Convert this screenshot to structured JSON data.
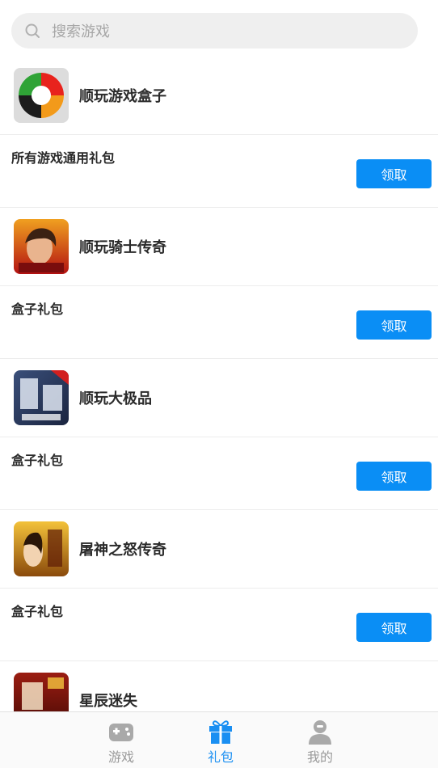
{
  "search": {
    "placeholder": "搜索游戏"
  },
  "games": [
    {
      "name": "顺玩游戏盒子",
      "icon": "shunwan-box-logo-icon",
      "gift": "所有游戏通用礼包",
      "button": "领取"
    },
    {
      "name": "顺玩骑士传奇",
      "icon": "knight-legend-game-icon",
      "gift": "盒子礼包",
      "button": "领取"
    },
    {
      "name": "顺玩大极品",
      "icon": "da-ji-pin-game-icon",
      "gift": "盒子礼包",
      "button": "领取"
    },
    {
      "name": "屠神之怒传奇",
      "icon": "tu-shen-game-icon",
      "gift": "盒子礼包",
      "button": "领取"
    },
    {
      "name": "星辰迷失",
      "icon": "xing-chen-game-icon"
    }
  ],
  "tabs": [
    {
      "label": "游戏",
      "icon": "gamepad-icon",
      "active": false
    },
    {
      "label": "礼包",
      "icon": "gift-icon",
      "active": true
    },
    {
      "label": "我的",
      "icon": "user-icon",
      "active": false
    }
  ],
  "colors": {
    "accent": "#0a8ef5",
    "tab_active": "#1a8ff2",
    "tab_inactive": "#9a9a9a"
  }
}
